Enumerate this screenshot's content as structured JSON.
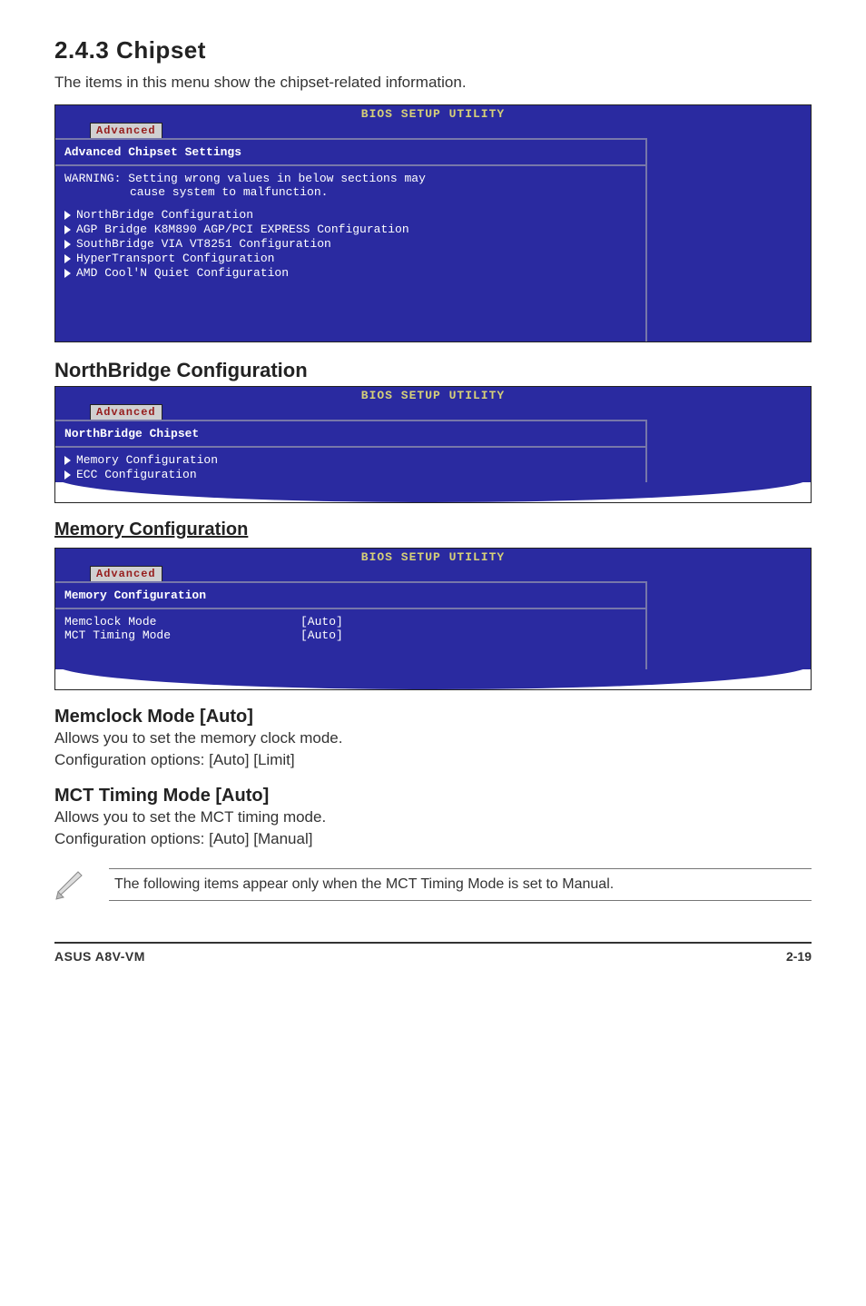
{
  "section": {
    "number_title": "2.4.3   Chipset",
    "intro": "The items in this menu show the chipset-related information."
  },
  "bios_common": {
    "title": "BIOS SETUP UTILITY",
    "tab": "Advanced"
  },
  "bios1": {
    "panel_header": "Advanced Chipset Settings",
    "warning_line1": "WARNING: Setting wrong values in below sections may",
    "warning_line2": "cause system to malfunction.",
    "items": [
      "NorthBridge Configuration",
      "AGP Bridge K8M890 AGP/PCI EXPRESS Configuration",
      "SouthBridge VIA VT8251 Configuration",
      "HyperTransport Configuration",
      "AMD Cool'N Quiet Configuration"
    ]
  },
  "northbridge_heading": "NorthBridge Configuration",
  "bios2": {
    "panel_header": "NorthBridge Chipset",
    "items": [
      "Memory Configuration",
      "ECC Configuration"
    ]
  },
  "memory_heading": "Memory Configuration",
  "bios3": {
    "panel_header": "Memory Configuration",
    "rows": [
      {
        "k": "Memclock Mode",
        "v": "[Auto]"
      },
      {
        "k": "MCT Timing Mode",
        "v": "[Auto]"
      }
    ]
  },
  "opt1": {
    "head": "Memclock Mode [Auto]",
    "l1": "Allows you to set the memory clock mode.",
    "l2": "Configuration options: [Auto] [Limit]"
  },
  "opt2": {
    "head": "MCT Timing Mode [Auto]",
    "l1": "Allows you to set the MCT timing mode.",
    "l2": "Configuration options: [Auto] [Manual]"
  },
  "note": "The following items appear only when the MCT Timing Mode is set to Manual.",
  "footer": {
    "left": "ASUS A8V-VM",
    "right": "2-19"
  }
}
